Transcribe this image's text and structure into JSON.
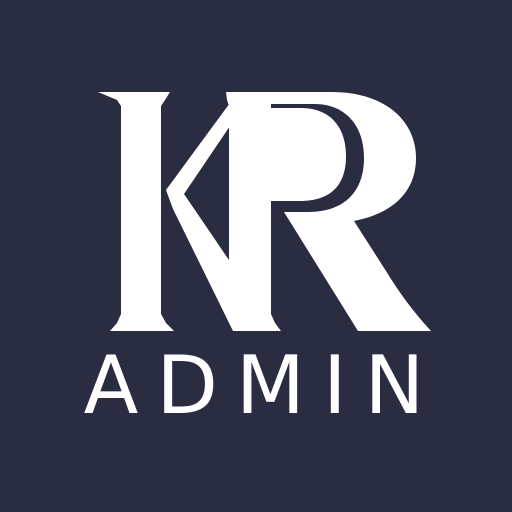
{
  "app_icon": {
    "monogram": "KR",
    "label": "ADMIN",
    "colors": {
      "background": "#2a2c42",
      "foreground": "#ffffff"
    }
  }
}
